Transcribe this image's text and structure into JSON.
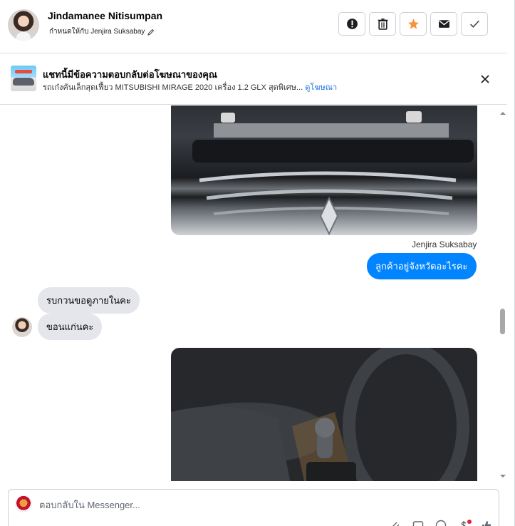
{
  "header": {
    "contact_name": "Jindamanee Nitisumpan",
    "assigned_text": "กำหนดให้กับ Jenjira Suksabay"
  },
  "banner": {
    "title": "แชทนี้มีข้อความตอบกลับต่อโฆษณาของคุณ",
    "subtitle": "รถเก๋งคันเล็กสุดเฟี้ยว MITSUBISHI MIRAGE 2020 เครื่อง 1.2 GLX สุดพิเศษ...",
    "link": "ดูโฆษณา"
  },
  "messages": {
    "sender_name": "Jenjira Suksabay",
    "outgoing_1": "ลูกค้าอยู่จังหวัดอะไรคะ",
    "incoming_1": "รบกวนขอดูภายในคะ",
    "incoming_2": "ขอนแก่นคะ"
  },
  "composer": {
    "placeholder": "ตอบกลับใน Messenger..."
  },
  "colors": {
    "accent": "#0084ff",
    "star": "#f7923a",
    "link": "#1b74e4"
  }
}
